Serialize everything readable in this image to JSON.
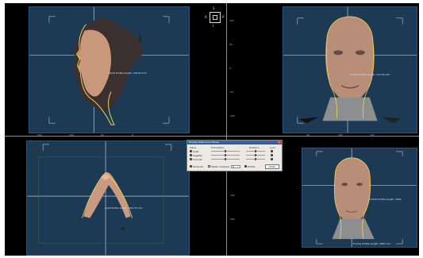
{
  "viewports": {
    "profile_left": {
      "label": "Right Profile length: 192.93 mm"
    },
    "frontal": {
      "label": "Frontal Profile length: 175.43 mm"
    },
    "axial": {
      "label": "Axial Profile length: 290.75 mm"
    },
    "frontal_small": {
      "label_right": "Frontal Profile length: 1861",
      "label_bottom": "Frontal Profile length: 1861 mm"
    }
  },
  "navigator": {
    "top": "S",
    "left": "A",
    "right": "P",
    "bottom": "I"
  },
  "ruler": {
    "vertical_ticks": [
      "100",
      "50",
      "0",
      "-50",
      "-100",
      "-150",
      "-200"
    ],
    "horizontal_ticks": [
      "-150",
      "-100",
      "-50",
      "0",
      "50",
      "100",
      "150"
    ]
  },
  "dialog": {
    "title": "Display Reference Planes",
    "close_glyph": "×",
    "headers": {
      "plane": "Plane",
      "translation": "Translation",
      "rotation": "Rotation",
      "lock": "Lock"
    },
    "planes": [
      {
        "label": "Axial",
        "checked": true,
        "lock": true
      },
      {
        "label": "Sagittal",
        "checked": true,
        "lock": true
      },
      {
        "label": "Coronal",
        "checked": true,
        "lock": true
      }
    ],
    "bottom": {
      "show_all": "Show All",
      "plastic_analysis": "Plastic Analysis",
      "value": "0",
      "profile": "Profile",
      "close_button": "Close"
    }
  },
  "colors": {
    "viewport_bg": "#1d3a55",
    "crosshair": "#d9e2ee",
    "profile_line": "#f2d54a",
    "ruler_green": "#2fd03a",
    "dialog_title_bar": "#2a5697"
  },
  "icons": {
    "nav_cube": "navigation-cube-icon",
    "close": "close-icon"
  }
}
